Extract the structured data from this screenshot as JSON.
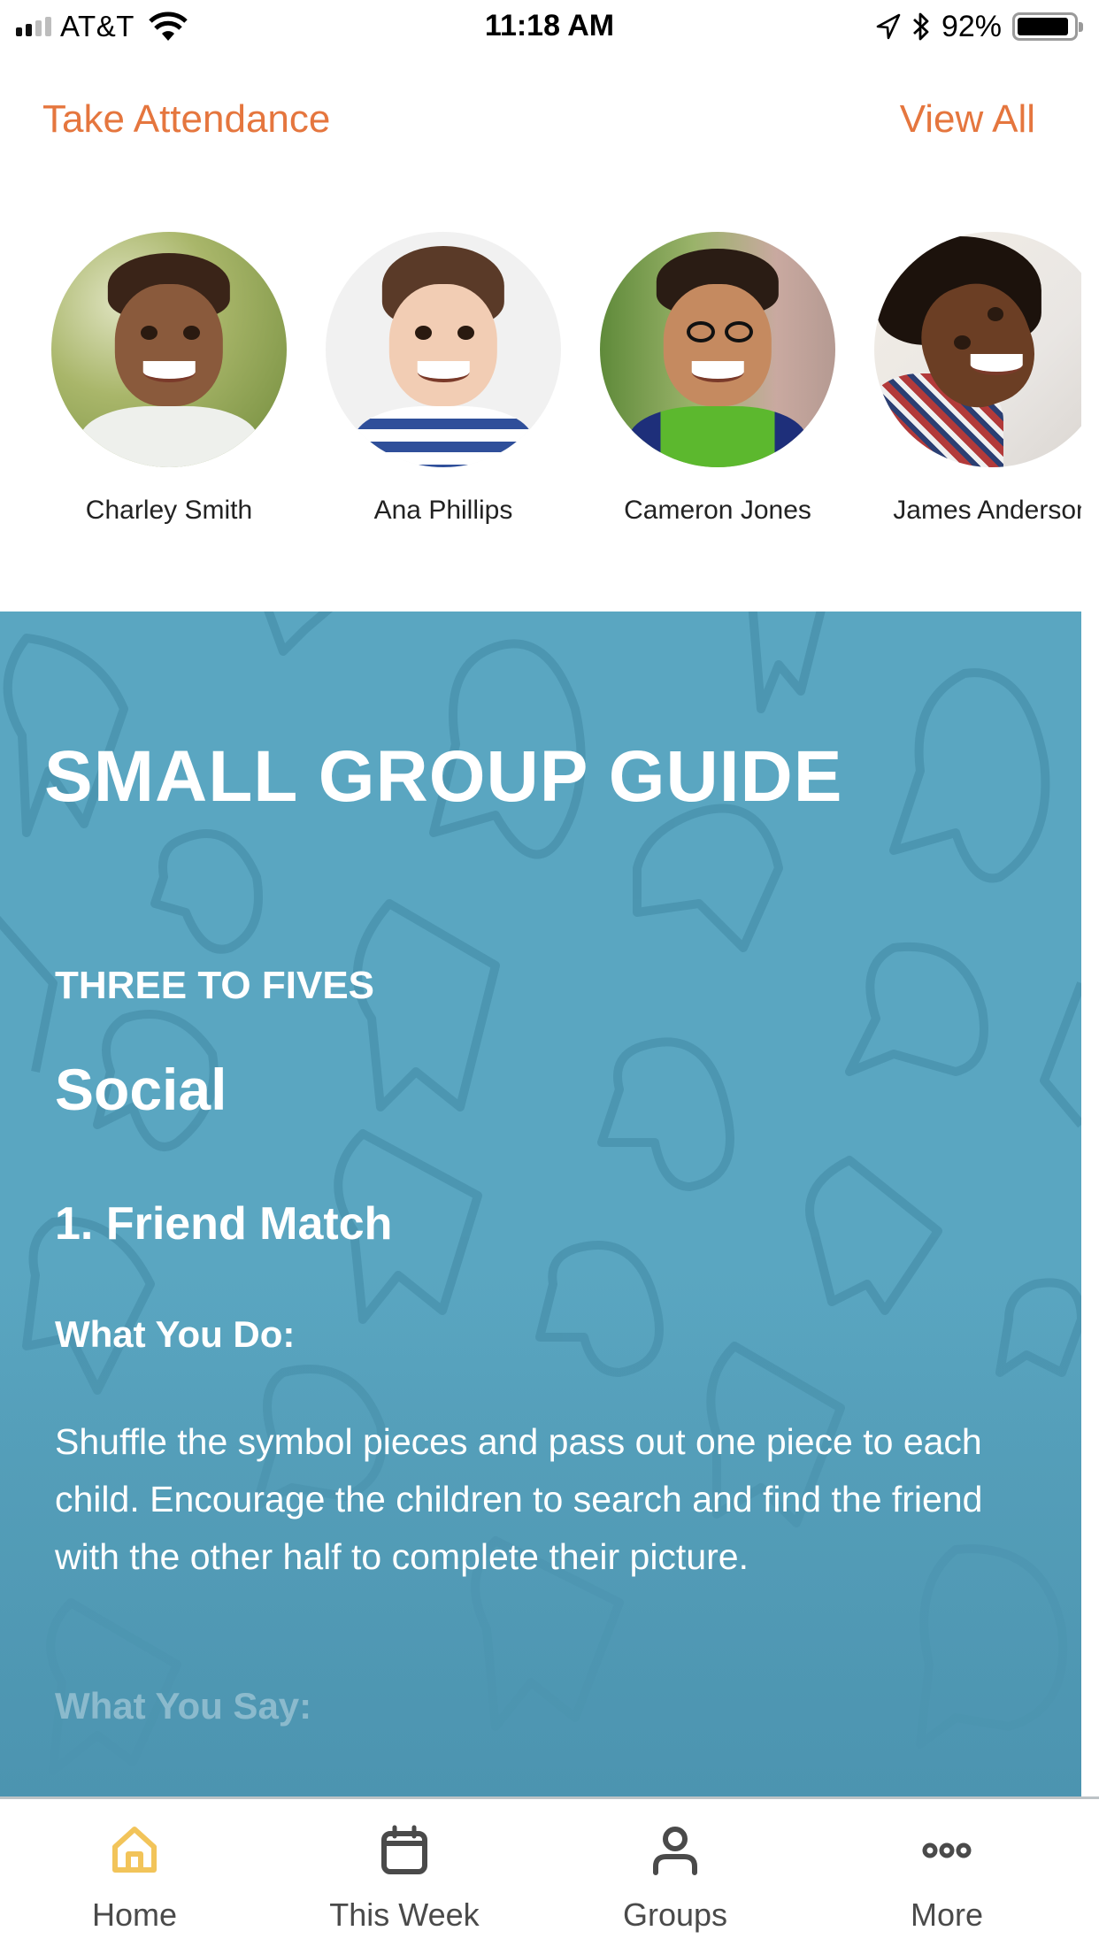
{
  "status_bar": {
    "carrier": "AT&T",
    "time": "11:18 AM",
    "battery_percent_label": "92%",
    "battery_level": 0.92,
    "signal_bars_active": 2,
    "signal_bars_total": 4,
    "icons": [
      "signal-icon",
      "wifi-icon",
      "location-arrow-icon",
      "bluetooth-icon",
      "battery-icon"
    ]
  },
  "attendance": {
    "title": "Take Attendance",
    "view_all_label": "View All",
    "accent_color": "#e5763e",
    "children": [
      {
        "name": "Charley Smith"
      },
      {
        "name": "Ana Phillips"
      },
      {
        "name": "Cameron Jones"
      },
      {
        "name": "James Anderson"
      }
    ]
  },
  "guide": {
    "title": "SMALL GROUP GUIDE",
    "age_group": "THREE TO FIVES",
    "category": "Social",
    "activity_title": "1. Friend Match",
    "what_you_do_heading": "What You Do:",
    "what_you_do_text": "Shuffle the symbol pieces and pass out one piece to each child. Encourage the children to search and find the friend with the other half to complete their picture.",
    "what_you_say_heading": "What You Say:",
    "background_color": "#5aa6c1"
  },
  "tab_bar": {
    "active_color": "#f2c45a",
    "inactive_color": "#4a4a4a",
    "tabs": [
      {
        "label": "Home",
        "icon": "home-icon",
        "active": true
      },
      {
        "label": "This Week",
        "icon": "calendar-icon",
        "active": false
      },
      {
        "label": "Groups",
        "icon": "person-icon",
        "active": false
      },
      {
        "label": "More",
        "icon": "more-dots-icon",
        "active": false
      }
    ]
  }
}
